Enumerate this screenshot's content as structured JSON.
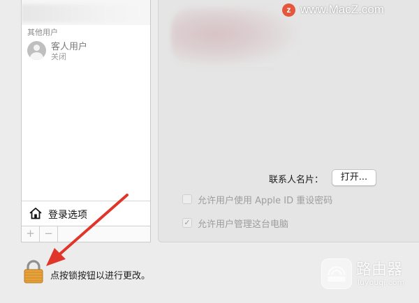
{
  "users": {
    "section_header": "其他用户",
    "guest": {
      "name": "客人用户",
      "status": "关闭"
    },
    "login_options_label": "登录选项",
    "toolbar": {
      "add_label": "+",
      "remove_label": "−"
    }
  },
  "detail": {
    "contact_card_label": "联系人名片：",
    "open_button_label": "打开...",
    "options": [
      {
        "label": "允许用户使用 Apple ID 重设密码",
        "checked": false,
        "enabled": false
      },
      {
        "label": "允许用户管理这台电脑",
        "checked": true,
        "enabled": false
      }
    ]
  },
  "lock": {
    "text": "点按锁按钮以进行更改。",
    "icon": "padlock-icon",
    "state": "locked"
  },
  "annotation": {
    "icon": "red-arrow-icon",
    "color": "#e0352b"
  },
  "watermarks": {
    "top": {
      "badge": "z",
      "text": "www.MacZ.com"
    },
    "bottom": {
      "name": "路由器",
      "domain": "luyouqi.com"
    }
  },
  "colors": {
    "arrow": "#e0352b",
    "lock_body": "#e6a23c",
    "badge": "#e4573c"
  }
}
